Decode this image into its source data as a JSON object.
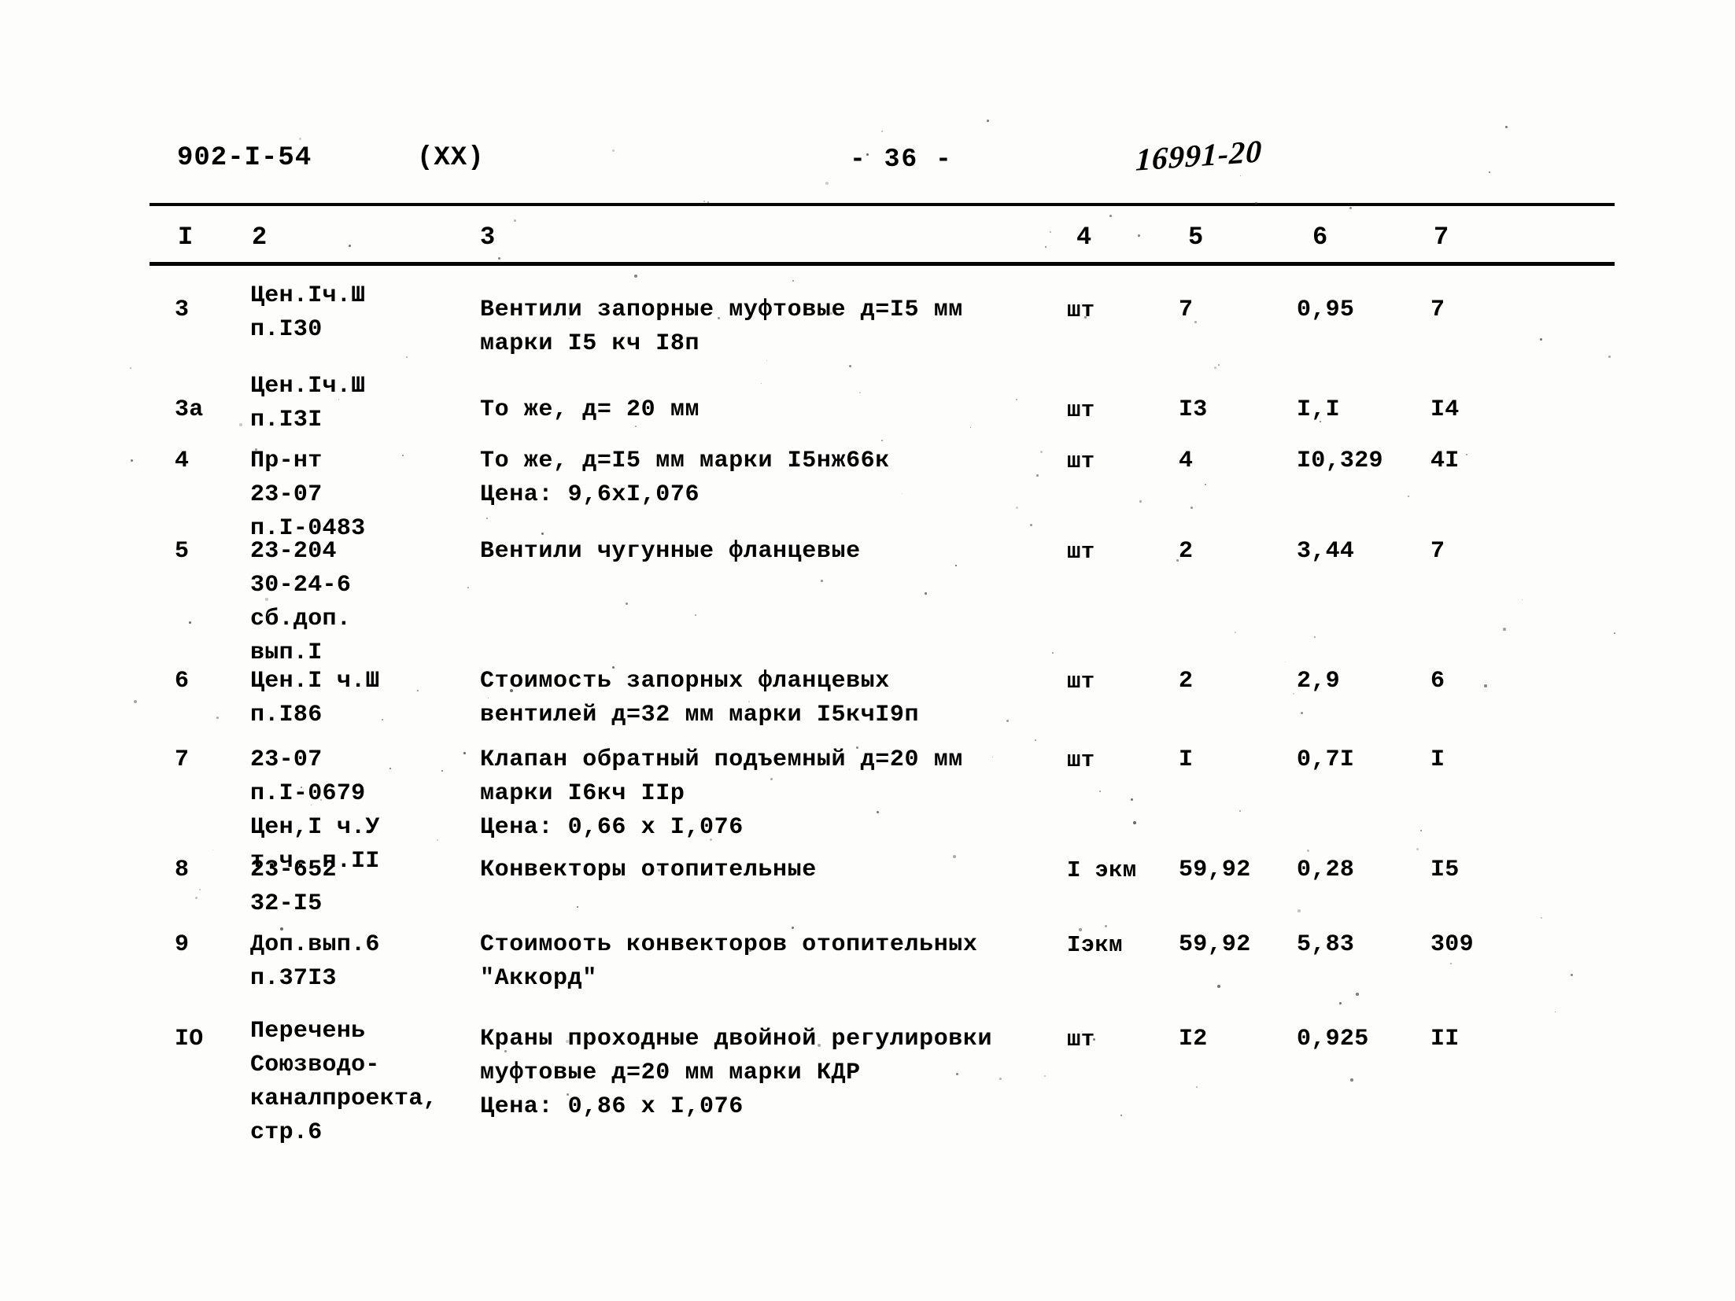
{
  "header": {
    "doc_code": "902-I-54",
    "variant": "(XX)",
    "page_number": "- 36 -",
    "archive_stamp": "16991-20"
  },
  "table": {
    "column_headers": [
      "I",
      "2",
      "3",
      "4",
      "5",
      "6",
      "7"
    ],
    "rows": [
      {
        "num": "3",
        "code": "Цен.Iч.Ш\nп.I30",
        "desc": "Вентили запорные муфтовые д=I5 мм\nмарки I5 кч I8п",
        "unit": "шт",
        "qty": "7",
        "price": "0,95",
        "total": "7"
      },
      {
        "num": "3а",
        "code": "Цен.Iч.Ш\nп.I3I",
        "desc": "То же, д= 20 мм",
        "unit": "шт",
        "qty": "I3",
        "price": "I,I",
        "total": "I4"
      },
      {
        "num": "4",
        "code": "Пр-нт\n23-07\nп.I-0483",
        "desc": "То же, д=I5 мм марки I5нж66к\nЦена: 9,6xI,076",
        "unit": "шт",
        "qty": "4",
        "price": "I0,329",
        "total": "4I"
      },
      {
        "num": "5",
        "code": "23-204\n30-24-6\nсб.доп.\nвып.I",
        "desc": "Вентили чугунные фланцевые",
        "unit": "шт",
        "qty": "2",
        "price": "3,44",
        "total": "7"
      },
      {
        "num": "6",
        "code": "Цен.I ч.Ш\nп.I86",
        "desc": "Стоимость запорных фланцевых\nвентилей д=32 мм марки I5кчI9п",
        "unit": "шт",
        "qty": "2",
        "price": "2,9",
        "total": "6"
      },
      {
        "num": "7",
        "code": "23-07\nп.I-0679\nЦен,I ч.У\nт.ч. п.II",
        "desc": "Клапан обратный подъемный д=20 мм\nмарки I6кч IIр\nЦена: 0,66 х I,076",
        "unit": "шт",
        "qty": "I",
        "price": "0,7I",
        "total": "I"
      },
      {
        "num": "8",
        "code": "23-652\n32-I5",
        "desc": "Конвекторы отопительные",
        "unit": "I экм",
        "qty": "59,92",
        "price": "0,28",
        "total": "I5"
      },
      {
        "num": "9",
        "code": "Доп.вып.6\nп.37I3",
        "desc": "Стоимооть конвекторов отопительных\n\"Аккорд\"",
        "unit": "Iэкм",
        "qty": "59,92",
        "price": "5,83",
        "total": "309"
      },
      {
        "num": "IO",
        "code": "Перечень\nСоюзводо-\nканалпроекта,\nстр.6",
        "desc": "Краны проходные двойной регулировки\nмуфтовые д=20 мм марки КДР\nЦена: 0,86 х I,076",
        "unit": "шт",
        "qty": "I2",
        "price": "0,925",
        "total": "II"
      }
    ]
  }
}
